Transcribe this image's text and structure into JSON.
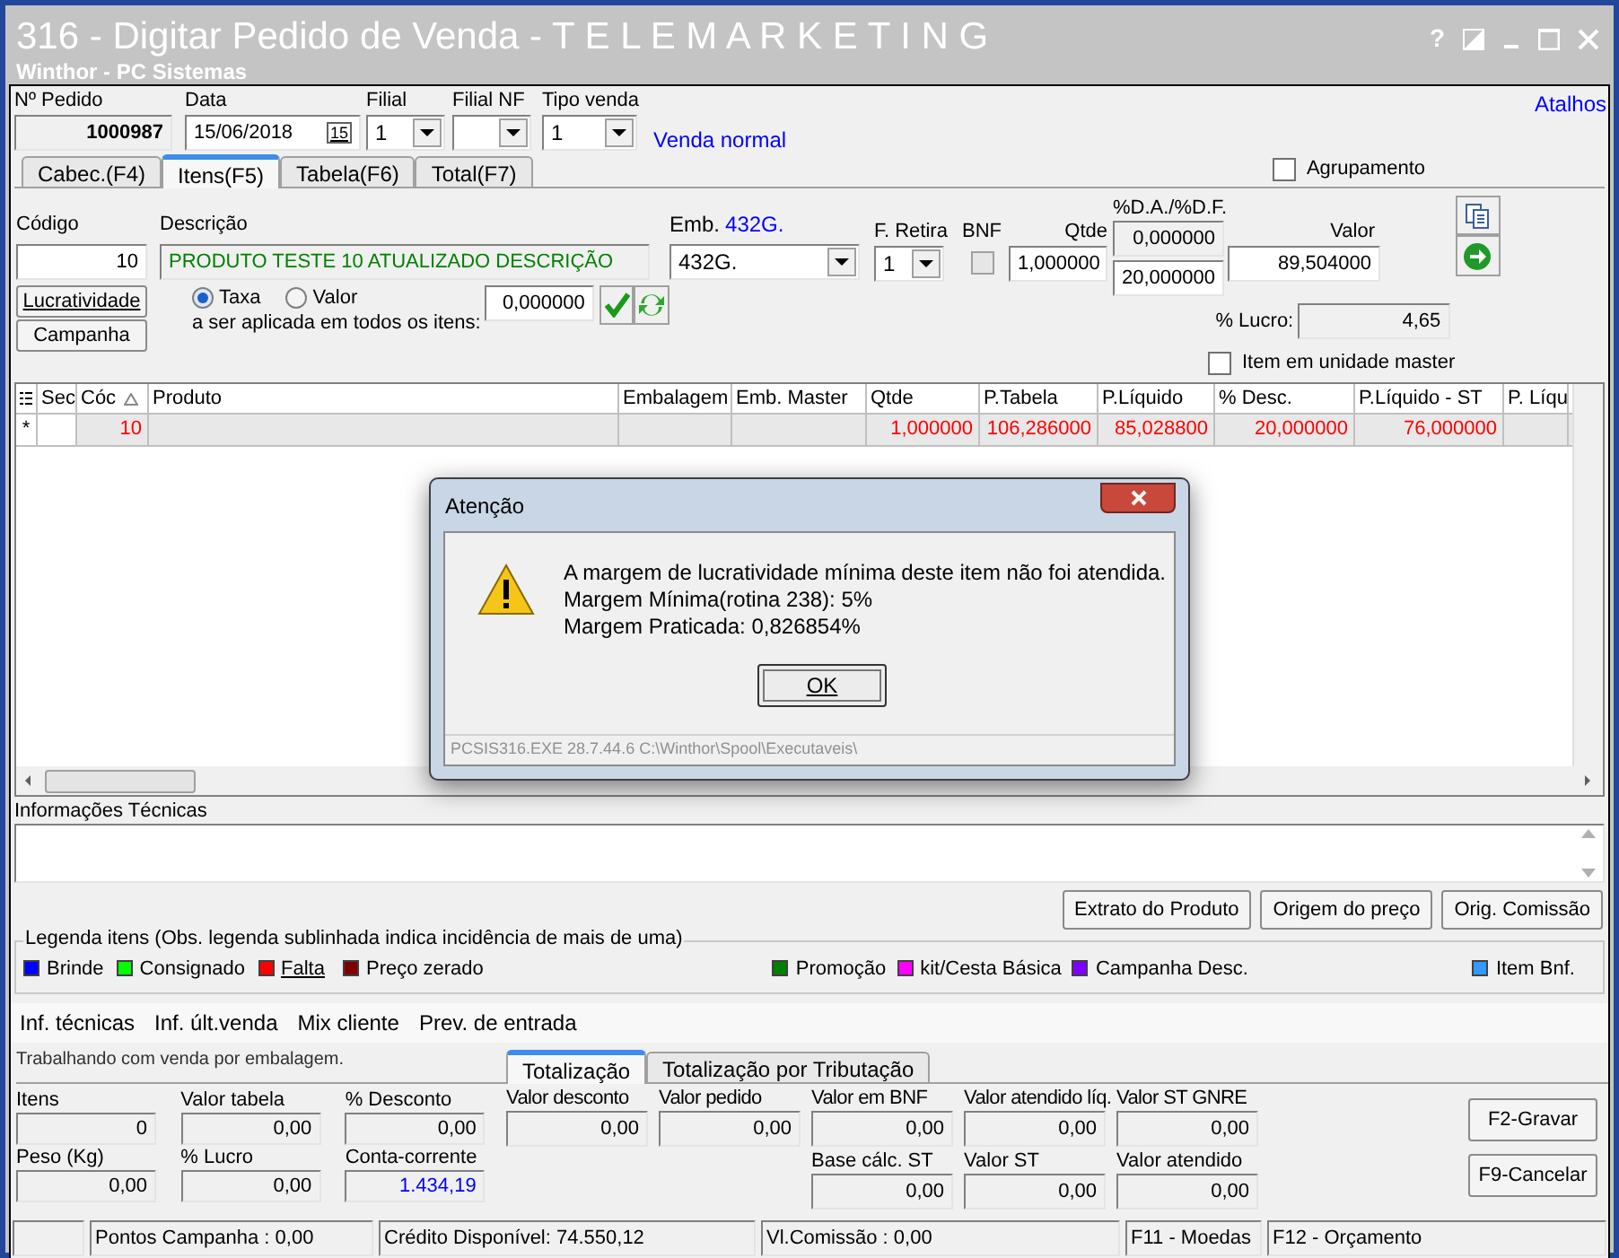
{
  "window": {
    "title": "316 - Digitar Pedido de Venda - T E L E M A R K E T I N G",
    "subtitle": "Winthor - PC Sistemas",
    "help": "?"
  },
  "shortcuts_link": "Atalhos",
  "header": {
    "order_no": {
      "label": "Nº Pedido",
      "value": "1000987"
    },
    "date": {
      "label": "Data",
      "value": "15/06/2018",
      "calendar_glyph": "15"
    },
    "filial": {
      "label": "Filial",
      "value": "1"
    },
    "filial_nf": {
      "label": "Filial NF"
    },
    "tipo_venda": {
      "label": "Tipo venda",
      "value": "1",
      "description": "Venda normal"
    }
  },
  "tabs": [
    {
      "label": "Cabec.(F4)",
      "selected": false
    },
    {
      "label": "Itens(F5)",
      "selected": true
    },
    {
      "label": "Tabela(F6)",
      "selected": false
    },
    {
      "label": "Total(F7)",
      "selected": false
    }
  ],
  "agrupamento": {
    "label": "Agrupamento",
    "checked": false
  },
  "item_entry": {
    "codigo": {
      "label": "Código",
      "value": "10"
    },
    "descricao": {
      "label": "Descrição",
      "value": "PRODUTO TESTE 10 ATUALIZADO DESCRIÇÃO"
    },
    "embalagem": {
      "label": "Emb.",
      "label_value": "432G.",
      "value": "432G."
    },
    "f_retira": {
      "label": "F. Retira",
      "value": "1"
    },
    "bnf": {
      "label": "BNF",
      "checked": false
    },
    "qtde": {
      "label": "Qtde",
      "value": "1,000000"
    },
    "discount": {
      "label": "%D.A./%D.F.",
      "da": "0,000000",
      "df": "20,000000"
    },
    "valor": {
      "label": "Valor",
      "value": "89,504000"
    },
    "lucratividade_button": "Lucratividade",
    "campanha_button": "Campanha",
    "rate_options": [
      {
        "label": "Taxa",
        "selected": true
      },
      {
        "label": "Valor",
        "selected": false
      }
    ],
    "apply_label": "a ser aplicada em todos os itens:",
    "apply_value": "0,000000",
    "lucro": {
      "label": "% Lucro:",
      "value": "4,65"
    },
    "unidade_master": {
      "label": "Item em unidade master",
      "checked": false
    }
  },
  "grid": {
    "columns": [
      "Sec",
      "Cóc",
      "Produto",
      "Embalagem",
      "Emb. Master",
      "Qtde",
      "P.Tabela",
      "P.Líquido",
      "% Desc.",
      "P.Líquido - ST",
      "P. Líqu"
    ],
    "rows": [
      {
        "indicator": "*",
        "cod": "10",
        "qtde": "1,000000",
        "p_tabela": "106,286000",
        "p_liquido": "85,028800",
        "desc": "20,000000",
        "p_liquido_st": "76,000000",
        "color": "#ff0000"
      }
    ]
  },
  "dialog": {
    "title": "Atenção",
    "lines": [
      "A margem de lucratividade mínima deste item não foi atendida.",
      "Margem Mínima(rotina 238): 5%",
      "Margem Praticada: 0,826854%"
    ],
    "ok": "OK",
    "footer": "PCSIS316.EXE 28.7.44.6 C:\\Winthor\\Spool\\Executaveis\\"
  },
  "tech_info": {
    "label": "Informações Técnicas"
  },
  "action_buttons": [
    "Extrato do Produto",
    "Origem do preço",
    "Orig. Comissão"
  ],
  "legend": {
    "title": "Legenda itens (Obs. legenda sublinhada indica incidência de mais de uma)",
    "items": [
      {
        "label": "Brinde",
        "color": "#0000ff",
        "underlined": false
      },
      {
        "label": "Consignado",
        "color": "#00ff00",
        "underlined": false
      },
      {
        "label": "Falta",
        "color": "#ff0000",
        "underlined": true
      },
      {
        "label": "Preço zerado",
        "color": "#800000",
        "underlined": false
      },
      {
        "label": "Promoção",
        "color": "#008000",
        "underlined": false
      },
      {
        "label": "kit/Cesta Básica",
        "color": "#ff00ff",
        "underlined": false
      },
      {
        "label": "Campanha Desc.",
        "color": "#8000ff",
        "underlined": false
      },
      {
        "label": "Item Bnf.",
        "color": "#3399ff",
        "underlined": false
      }
    ]
  },
  "menu": [
    "Inf. técnicas",
    "Inf. últ.venda",
    "Mix cliente",
    "Prev. de entrada"
  ],
  "info_text": "Trabalhando com venda por embalagem.",
  "summary_tabs": [
    {
      "label": "Totalização",
      "selected": true
    },
    {
      "label": "Totalização por Tributação",
      "selected": false
    }
  ],
  "totals_left": [
    {
      "label": "Itens",
      "value": "0",
      "color": "#000000"
    },
    {
      "label": "Valor tabela",
      "value": "0,00",
      "color": "#000000"
    },
    {
      "label": "% Desconto",
      "value": "0,00",
      "color": "#000000"
    },
    {
      "label": "Peso (Kg)",
      "value": "0,00",
      "color": "#000000"
    },
    {
      "label": "% Lucro",
      "value": "0,00",
      "color": "#000000"
    },
    {
      "label": "Conta-corrente",
      "value": "1.434,19",
      "color": "#0000ff"
    }
  ],
  "totals_row1": [
    {
      "label": "Valor desconto",
      "value": "0,00"
    },
    {
      "label": "Valor pedido",
      "value": "0,00"
    },
    {
      "label": "Valor em BNF",
      "value": "0,00"
    },
    {
      "label": "Valor atendido líq.",
      "value": "0,00"
    },
    {
      "label": "Valor ST GNRE",
      "value": "0,00"
    }
  ],
  "totals_row2": [
    {
      "label": "Base cálc. ST",
      "value": "0,00"
    },
    {
      "label": "Valor ST",
      "value": "0,00"
    },
    {
      "label": "Valor atendido",
      "value": "0,00"
    }
  ],
  "buttons": [
    "F2-Gravar",
    "F9-Cancelar"
  ],
  "status_bar": [
    "Pontos Campanha : 0,00",
    "Crédito Disponível: 74.550,12",
    "Vl.Comissão : 0,00",
    "F11 - Moedas",
    "F12 - Orçamento"
  ]
}
